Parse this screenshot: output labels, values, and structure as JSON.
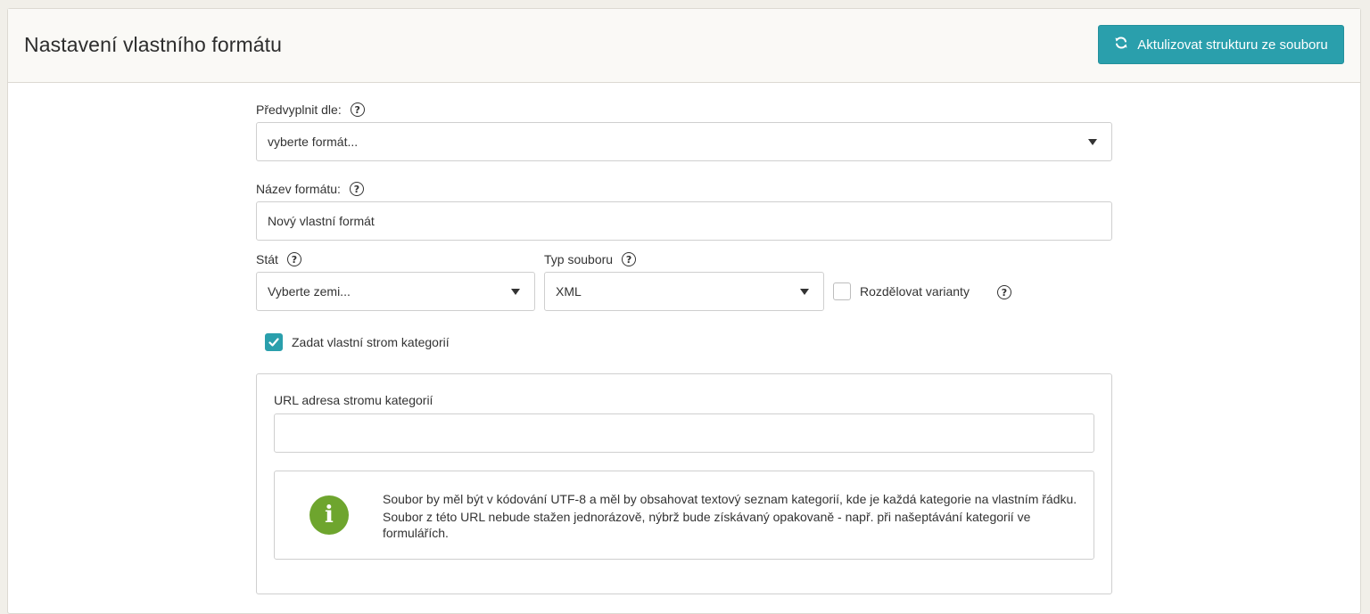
{
  "header": {
    "title": "Nastavení vlastního formátu",
    "refresh_button_label": "Aktulizovat strukturu ze souboru"
  },
  "form": {
    "prefill_label": "Předvyplnit dle:",
    "prefill_value": "vyberte formát...",
    "format_name_label": "Název formátu:",
    "format_name_value": "Nový vlastní formát",
    "country_label": "Stát",
    "country_value": "Vyberte zemi...",
    "file_type_label": "Typ souboru",
    "file_type_value": "XML",
    "split_variants_label": "Rozdělovat varianty",
    "split_variants_checked": false,
    "custom_tree_label": "Zadat vlastní strom kategorií",
    "custom_tree_checked": true,
    "url_label": "URL adresa stromu kategorií",
    "url_value": ""
  },
  "info": {
    "line1": "Soubor by měl být v kódování UTF-8 a měl by obsahovat textový seznam kategorií, kde je každá kategorie na vlastním řádku.",
    "line2": "Soubor z této URL nebude stažen jednorázově, nýbrž bude získávaný opakovaně - např. při našeptávání kategorií ve formulářích."
  },
  "help_glyph": "?",
  "info_glyph": "i",
  "colors": {
    "accent": "#2a9fac",
    "info_green": "#6ea52e"
  },
  "icons": [
    "refresh-icon",
    "help-icon",
    "caret-down-icon",
    "check-icon",
    "info-icon"
  ]
}
